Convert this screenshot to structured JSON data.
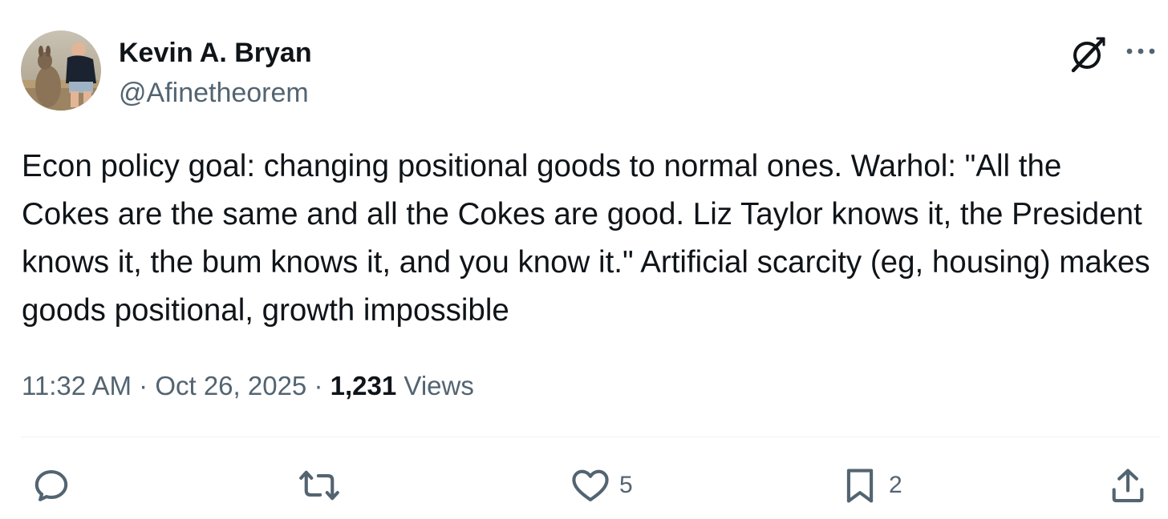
{
  "author": {
    "name": "Kevin A. Bryan",
    "handle": "@Afinetheorem"
  },
  "tweet": {
    "text": "Econ policy goal: changing positional goods to normal ones. Warhol: \"All the Cokes are the same and all the Cokes are good. Liz Taylor knows it, the President knows it, the bum knows it, and you know it.\" Artificial scarcity (eg, housing) makes goods positional, growth impossible"
  },
  "meta": {
    "time": "11:32 AM",
    "separator": "·",
    "date": "Oct 26, 2025",
    "views_count": "1,231",
    "views_label": "Views"
  },
  "actions": {
    "reply": {
      "icon": "reply-icon",
      "count": ""
    },
    "retweet": {
      "icon": "retweet-icon",
      "count": ""
    },
    "like": {
      "icon": "heart-icon",
      "count": "5"
    },
    "bookmark": {
      "icon": "bookmark-icon",
      "count": "2"
    },
    "share": {
      "icon": "share-icon",
      "count": ""
    }
  },
  "header_icons": [
    "grok-icon",
    "more-icon"
  ],
  "colors": {
    "text_primary": "#0f1419",
    "text_secondary": "#536471",
    "divider": "#eff3f4"
  }
}
